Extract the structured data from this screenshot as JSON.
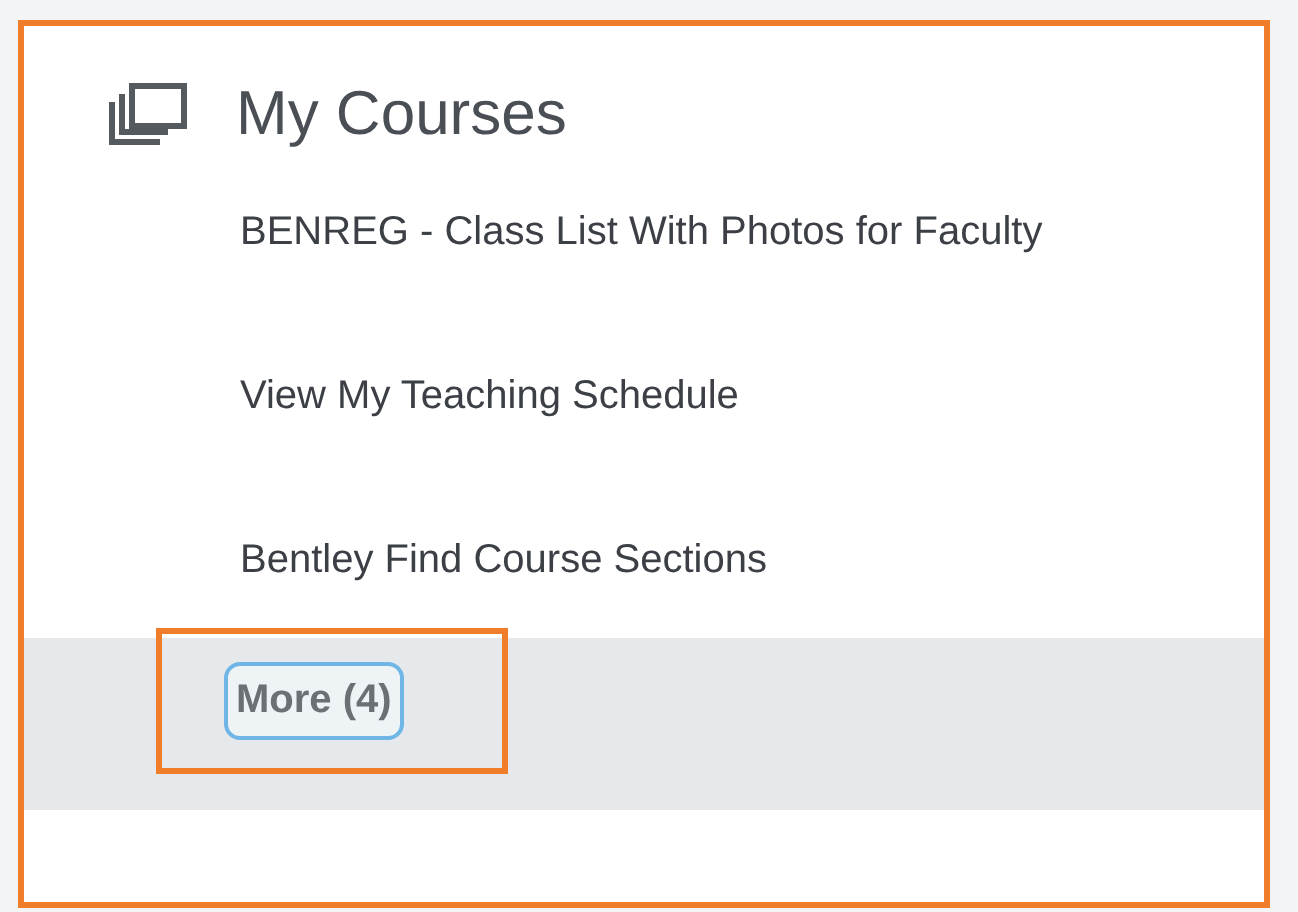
{
  "card": {
    "title": "My Courses",
    "links": [
      "BENREG - Class List With Photos for Faculty",
      "View My Teaching Schedule",
      "Bentley Find Course Sections"
    ],
    "more_button": {
      "label": "More (4)",
      "highlighted": true
    }
  }
}
